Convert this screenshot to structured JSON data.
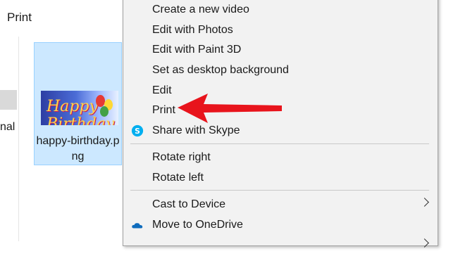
{
  "toolbar": {
    "title": "Print"
  },
  "nav": {
    "truncated_label": "nal"
  },
  "file": {
    "name_line1": "happy-birthday.p",
    "name_line2": "ng",
    "thumb_text": "Happy Birthday"
  },
  "context_menu": {
    "items": [
      {
        "label": "Create a new video"
      },
      {
        "label": "Edit with Photos"
      },
      {
        "label": "Edit with Paint 3D"
      },
      {
        "label": "Set as desktop background"
      },
      {
        "label": "Edit"
      },
      {
        "label": "Print"
      },
      {
        "label": "Share with Skype",
        "icon": "skype-icon"
      },
      {
        "label": "Rotate right"
      },
      {
        "label": "Rotate left"
      },
      {
        "label": "Cast to Device",
        "submenu": true
      },
      {
        "label": "Move to OneDrive",
        "icon": "onedrive-icon"
      }
    ]
  },
  "annotation": {
    "arrow_color": "#e8141c",
    "points_to": "Print"
  },
  "colors": {
    "selection_fill": "#cce8ff",
    "selection_border": "#99d1ff",
    "menu_bg": "#f2f2f2",
    "skype_blue": "#00aff0",
    "onedrive_blue": "#0f6cbd"
  }
}
